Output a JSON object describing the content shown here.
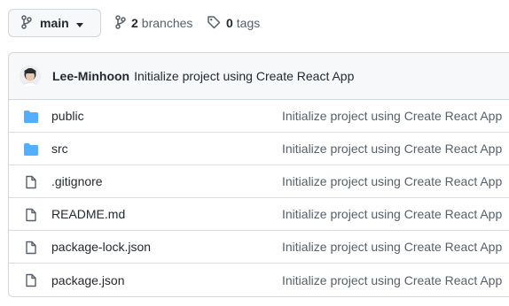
{
  "branch": {
    "name": "main"
  },
  "meta": {
    "branches_count": "2",
    "branches_label": "branches",
    "tags_count": "0",
    "tags_label": "tags"
  },
  "commit": {
    "author": "Lee-Minhoon",
    "message": "Initialize project using Create React App"
  },
  "files": [
    {
      "type": "folder",
      "name": "public",
      "message": "Initialize project using Create React App"
    },
    {
      "type": "folder",
      "name": "src",
      "message": "Initialize project using Create React App"
    },
    {
      "type": "file",
      "name": ".gitignore",
      "message": "Initialize project using Create React App"
    },
    {
      "type": "file",
      "name": "README.md",
      "message": "Initialize project using Create React App"
    },
    {
      "type": "file",
      "name": "package-lock.json",
      "message": "Initialize project using Create React App"
    },
    {
      "type": "file",
      "name": "package.json",
      "message": "Initialize project using Create React App"
    }
  ],
  "colors": {
    "folder": "#54aeff",
    "file": "#57606a"
  }
}
